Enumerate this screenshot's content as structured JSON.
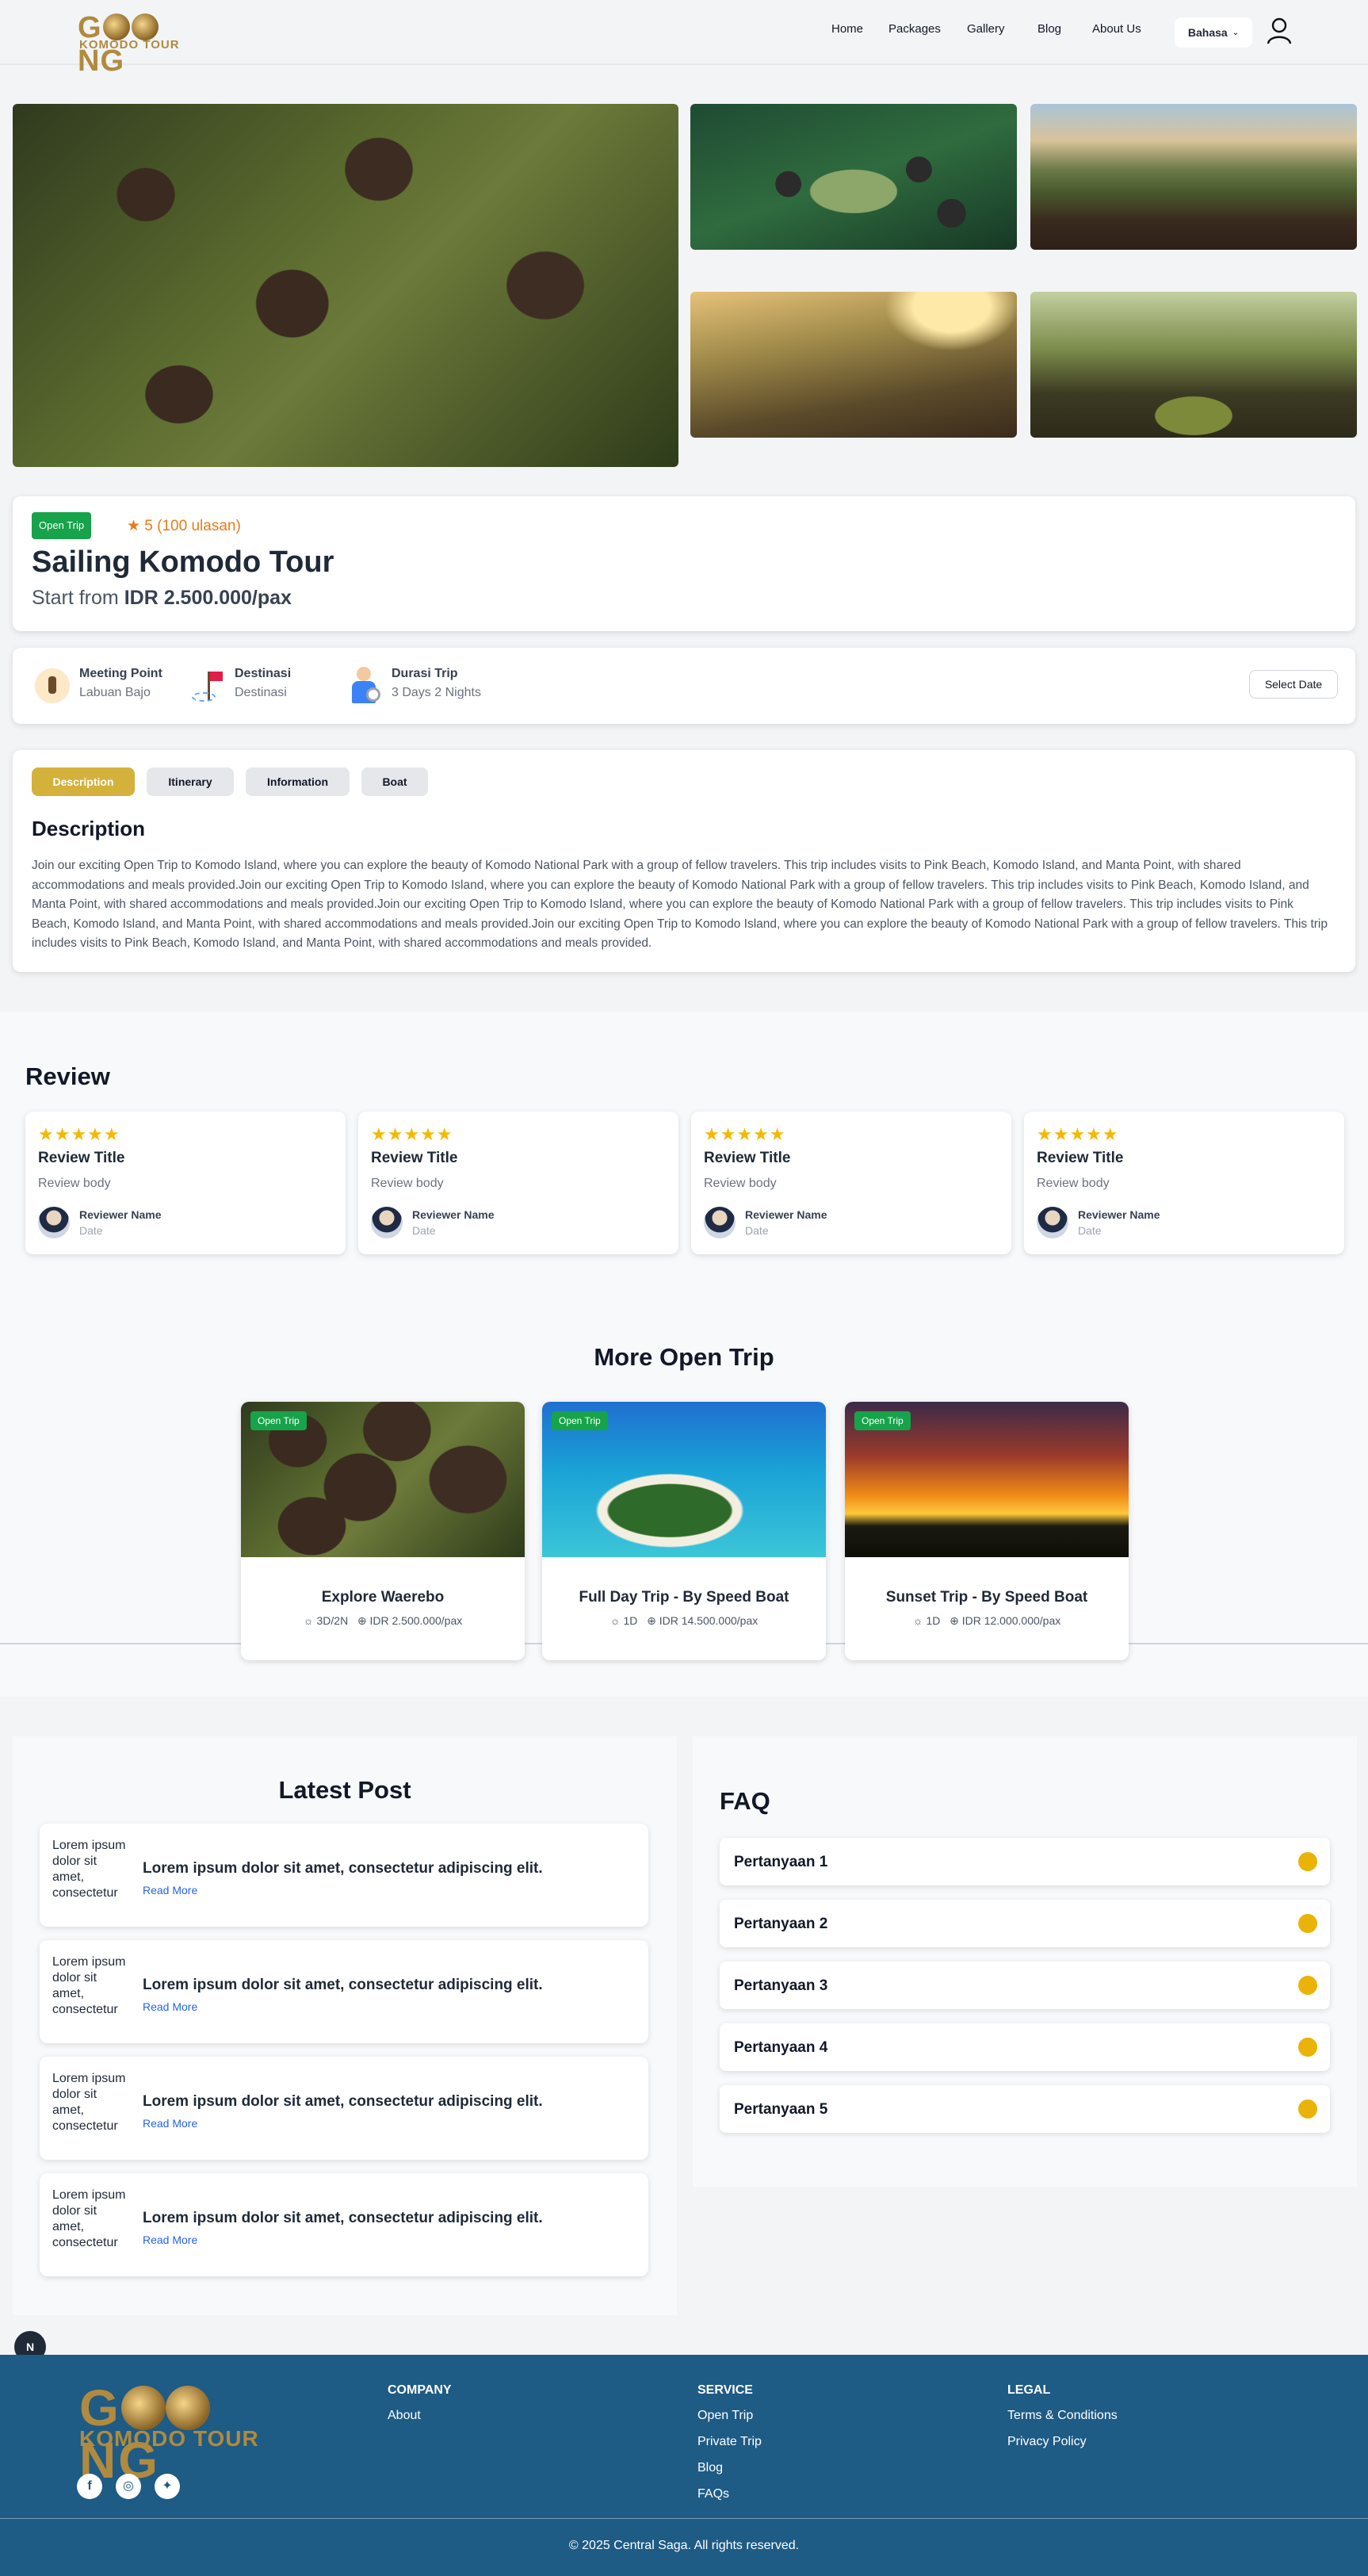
{
  "nav": {
    "logo_top": "G  NG",
    "logo_bottom": "KOMODO TOUR",
    "items": [
      "Home",
      "Packages",
      "Gallery",
      "Blog",
      "About Us"
    ],
    "lang": "Bahasa"
  },
  "trip": {
    "badge": "Open Trip",
    "rating": "★ 5 (100 ulasan)",
    "title": "Sailing Komodo Tour",
    "price_prefix": "Start from ",
    "price": "IDR 2.500.000/pax"
  },
  "info": {
    "meeting_label": "Meeting Point",
    "meeting_value": "Labuan Bajo",
    "dest_label": "Destinasi",
    "dest_value": "Destinasi",
    "duration_label": "Durasi Trip",
    "duration_value": "3 Days 2 Nights",
    "select_date": "Select Date"
  },
  "tabs": [
    "Description",
    "Itinerary",
    "Information",
    "Boat"
  ],
  "description": {
    "heading": "Description",
    "body": "Join our exciting Open Trip to Komodo Island, where you can explore the beauty of Komodo National Park with a group of fellow travelers. This trip includes visits to Pink Beach, Komodo Island, and Manta Point, with shared accommodations and meals provided.Join our exciting Open Trip to Komodo Island, where you can explore the beauty of Komodo National Park with a group of fellow travelers. This trip includes visits to Pink Beach, Komodo Island, and Manta Point, with shared accommodations and meals provided.Join our exciting Open Trip to Komodo Island, where you can explore the beauty of Komodo National Park with a group of fellow travelers. This trip includes visits to Pink Beach, Komodo Island, and Manta Point, with shared accommodations and meals provided.Join our exciting Open Trip to Komodo Island, where you can explore the beauty of Komodo National Park with a group of fellow travelers. This trip includes visits to Pink Beach, Komodo Island, and Manta Point, with shared accommodations and meals provided."
  },
  "review": {
    "heading": "Review",
    "stars": "★★★★★",
    "cards": [
      {
        "title": "Review Title",
        "body": "Review body",
        "name": "Reviewer Name",
        "date": "Date"
      },
      {
        "title": "Review Title",
        "body": "Review body",
        "name": "Reviewer Name",
        "date": "Date"
      },
      {
        "title": "Review Title",
        "body": "Review body",
        "name": "Reviewer Name",
        "date": "Date"
      },
      {
        "title": "Review Title",
        "body": "Review body",
        "name": "Reviewer Name",
        "date": "Date"
      }
    ]
  },
  "more": {
    "heading": "More Open Trip",
    "trips": [
      {
        "badge": "Open Trip",
        "name": "Explore Waerebo",
        "duration": "3D/2N",
        "price": "IDR 2.500.000/pax"
      },
      {
        "badge": "Open Trip",
        "name": "Full Day Trip - By Speed Boat",
        "duration": "1D",
        "price": "IDR 14.500.000/pax"
      },
      {
        "badge": "Open Trip",
        "name": "Sunset Trip - By Speed Boat",
        "duration": "1D",
        "price": "IDR 12.000.000/pax"
      }
    ]
  },
  "posts": {
    "heading": "Latest Post",
    "items": [
      {
        "alt": "Lorem ipsum dolor sit amet, consectetur",
        "title": "Lorem ipsum dolor sit amet, consectetur adipiscing elit.",
        "link": "Read More"
      },
      {
        "alt": "Lorem ipsum dolor sit amet, consectetur",
        "title": "Lorem ipsum dolor sit amet, consectetur adipiscing elit.",
        "link": "Read More"
      },
      {
        "alt": "Lorem ipsum dolor sit amet, consectetur",
        "title": "Lorem ipsum dolor sit amet, consectetur adipiscing elit.",
        "link": "Read More"
      },
      {
        "alt": "Lorem ipsum dolor sit amet, consectetur",
        "title": "Lorem ipsum dolor sit amet, consectetur adipiscing elit.",
        "link": "Read More"
      }
    ]
  },
  "faq": {
    "heading": "FAQ",
    "items": [
      "Pertanyaan 1",
      "Pertanyaan 2",
      "Pertanyaan 3",
      "Pertanyaan 4",
      "Pertanyaan 5"
    ]
  },
  "footer": {
    "company_head": "COMPANY",
    "company_links": [
      "About"
    ],
    "service_head": "SERVICE",
    "service_links": [
      "Open Trip",
      "Private Trip",
      "Blog",
      "FAQs"
    ],
    "legal_head": "LEGAL",
    "legal_links": [
      "Terms & Conditions",
      "Privacy Policy"
    ],
    "copyright": "© 2025 Central Saga. All rights reserved.",
    "next_badge": "N"
  },
  "colors": {
    "accent_gold": "#d4b13a",
    "badge_green": "#16a34a",
    "rating_orange": "#ea7a16",
    "footer_blue": "#1e5b85"
  }
}
